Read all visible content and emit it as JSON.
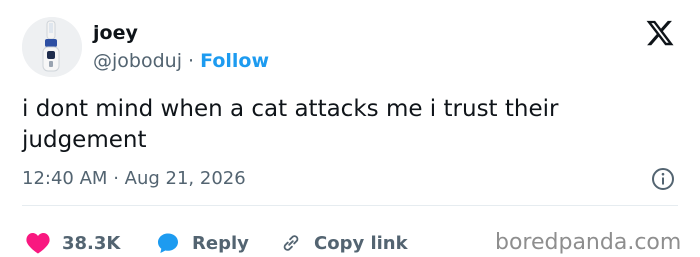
{
  "user": {
    "name": "joey",
    "handle": "@joboduj",
    "separator": "·",
    "follow_label": "Follow"
  },
  "tweet": {
    "text": "i dont mind when a cat attacks me i trust their judgement",
    "time": "12:40 AM",
    "date_separator": "·",
    "date": "Aug 21, 2026"
  },
  "actions": {
    "likes": "38.3K",
    "reply_label": "Reply",
    "copy_link_label": "Copy link"
  },
  "watermark": "boredpanda.com",
  "icons": {
    "logo": "x-logo-icon",
    "info": "info-icon",
    "heart": "heart-icon",
    "reply": "speech-bubble-icon",
    "link": "link-icon"
  },
  "colors": {
    "link_blue": "#1d9bf0",
    "like_pink": "#f91880",
    "muted_text": "#536471",
    "primary_text": "#0f1419"
  }
}
